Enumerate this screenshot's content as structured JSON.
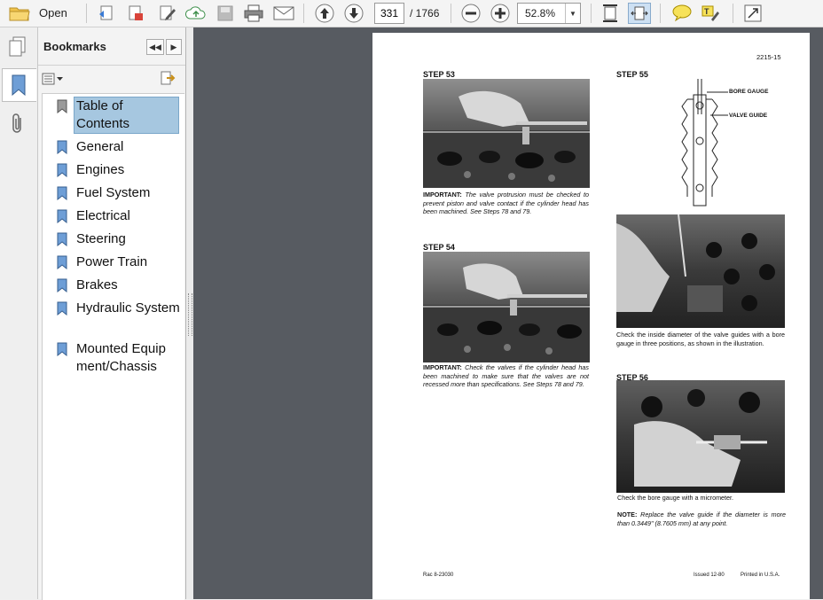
{
  "toolbar": {
    "open_label": "Open",
    "current_page": "331",
    "total_pages": "/ 1766",
    "zoom": "52.8%"
  },
  "sidebar": {
    "title": "Bookmarks",
    "items": [
      {
        "label": "Table of Contents"
      },
      {
        "label": "General"
      },
      {
        "label": "Engines"
      },
      {
        "label": "Fuel System"
      },
      {
        "label": "Electrical"
      },
      {
        "label": "Steering"
      },
      {
        "label": "Power Train"
      },
      {
        "label": "Brakes"
      },
      {
        "label": "Hydraulic System"
      },
      {
        "label": "Mounted Equipment/Chassis"
      }
    ]
  },
  "document": {
    "page_code": "2215-15",
    "step53": {
      "title": "STEP 53",
      "lead": "IMPORTANT:",
      "text": "The valve protrusion must be checked to prevent piston and valve contact if the cylinder head has been machined. See Steps 78 and 79."
    },
    "step54": {
      "title": "STEP 54",
      "lead": "IMPORTANT:",
      "text": "Check the valves if the cylinder head has been machined to make sure that the valves are not recessed more than specifications. See Steps 78 and 79."
    },
    "step55": {
      "title": "STEP 55",
      "label_bore": "BORE GAUGE",
      "label_guide": "VALVE GUIDE",
      "caption": "Check the inside diameter of the valve guides with a bore gauge in three positions, as shown in the illustration."
    },
    "step56": {
      "title": "STEP 56",
      "caption": "Check the bore gauge with a micrometer.",
      "note_lead": "NOTE:",
      "note_text": "Replace the valve guide if the diameter is more than 0.3449\" (8.7605 mm) at any point."
    },
    "footer": {
      "left": "Rac 8-23030",
      "issued": "Issued 12-80",
      "printed": "Printed in U.S.A."
    }
  }
}
